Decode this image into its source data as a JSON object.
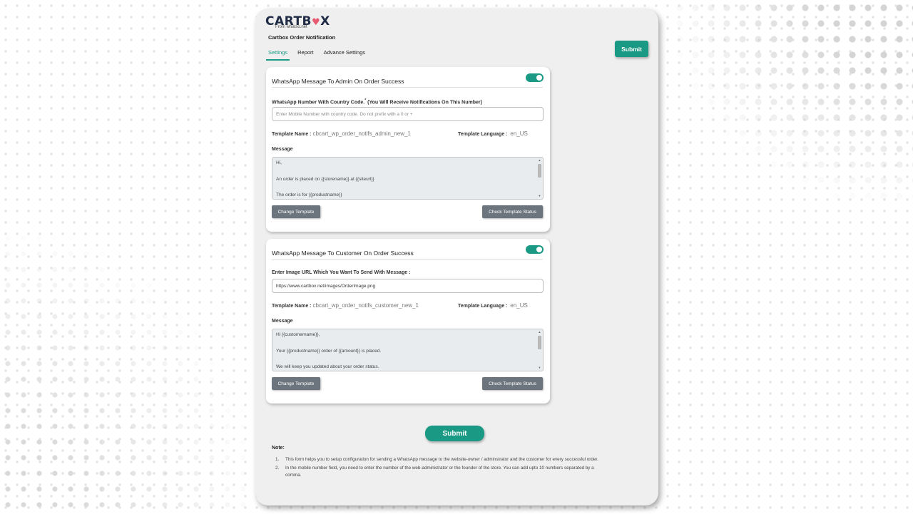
{
  "brand": {
    "logo_text_a": "CARTB",
    "logo_heart": "♥",
    "logo_text_b": "X",
    "subtitle": "From whatso.net"
  },
  "app_title": "Cartbox Order Notification",
  "tabs": [
    {
      "label": "Settings",
      "active": true
    },
    {
      "label": "Report",
      "active": false
    },
    {
      "label": "Advance Settings",
      "active": false
    }
  ],
  "header": {
    "submit_label": "Submit"
  },
  "admin_card": {
    "title": "WhatsApp Message To Admin On Order Success",
    "toggle_on": true,
    "number_label": "WhatsApp Number With Country Code.",
    "required_mark": "*",
    "number_hint": "(You Will Receive Notifications On This Number)",
    "number_placeholder": "Enter Mobile Number with country code. Do not prefix with a 0 or +",
    "number_value": "",
    "template_name_label": "Template Name :",
    "template_name_value": "cbcart_wp_order_notifs_admin_new_1",
    "template_lang_label": "Template Language :",
    "template_lang_value": "en_US",
    "message_label": "Message",
    "message_lines": [
      "Hi,",
      "An order is placed on {{storename}} at {{siteurl}}",
      "The order is for {{productname}}"
    ],
    "change_template_label": "Change Template",
    "check_status_label": "Check Template Status"
  },
  "customer_card": {
    "title": "WhatsApp Message To Customer On Order Success",
    "toggle_on": true,
    "image_label": "Enter Image URL Which You Want To Send With Message :",
    "image_value": "https://www.cartbox.net/images/OrderImage.png",
    "template_name_label": "Template Name :",
    "template_name_value": "cbcart_wp_order_notifs_customer_new_1",
    "template_lang_label": "Template Language :",
    "template_lang_value": "en_US",
    "message_label": "Message",
    "message_lines": [
      "Hi {{customername}},",
      "Your {{productname}} order of {{amount}} is placed.",
      "We will keep you updated about your order status."
    ],
    "change_template_label": "Change Template",
    "check_status_label": "Check Template Status"
  },
  "footer": {
    "submit_label": "Submit",
    "note_title": "Note:",
    "notes": [
      {
        "num": "1.",
        "text": "This form helps you to setup configuration for sending a WhatsApp message to the website-owner / adminstrator and the customer for every successful order."
      },
      {
        "num": "2.",
        "text": "In the mobile number field, you need to enter the number of the web-administrator or the founder of the store. You can add upto 10 numbers separated by a comma."
      }
    ]
  },
  "colors": {
    "accent": "#1a9a84",
    "panel_bg": "#efefef",
    "button_grey": "#6c757d",
    "logo_heart": "#e85a71"
  }
}
